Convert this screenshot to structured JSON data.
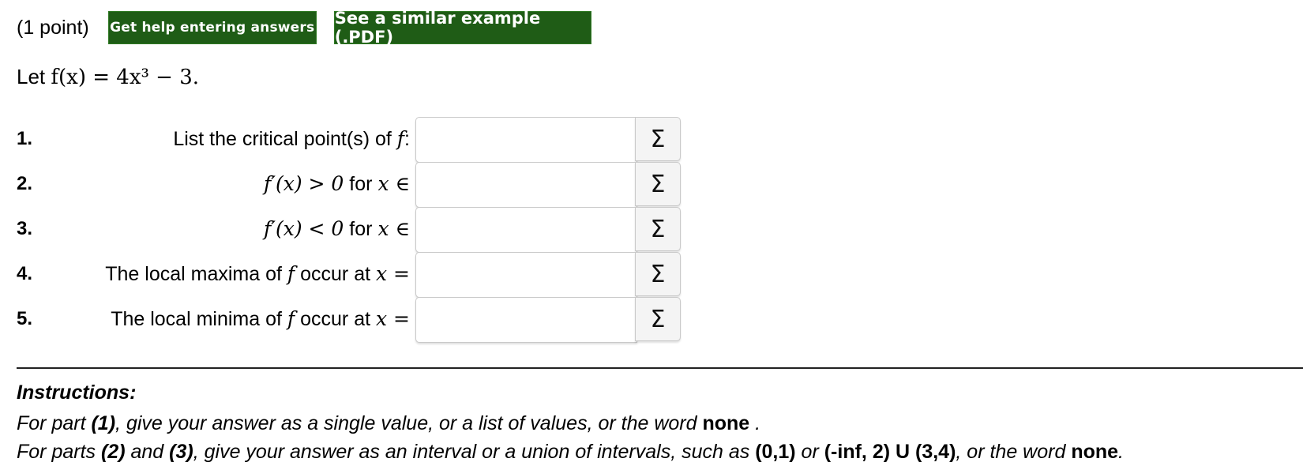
{
  "header": {
    "points": "(1 point)",
    "help_button": "Get help entering answers",
    "example_button": "See a similar example (.PDF)"
  },
  "problem": {
    "let_text": "Let",
    "function": "f(x) = 4x³ − 3."
  },
  "questions": [
    {
      "number": "1.",
      "label": "List the critical point(s) of",
      "math": "f",
      "suffix": ":",
      "answer": ""
    },
    {
      "number": "2.",
      "label_math": "f′(x) > 0",
      "label": "for",
      "math": "x ∈",
      "answer": ""
    },
    {
      "number": "3.",
      "label_math": "f′(x) < 0",
      "label": "for",
      "math": "x ∈",
      "answer": ""
    },
    {
      "number": "4.",
      "label": "The local maxima of",
      "math": "f",
      "suffix": "occur at",
      "math2": "x =",
      "answer": ""
    },
    {
      "number": "5.",
      "label": "The local minima of",
      "math": "f",
      "suffix": "occur at",
      "math2": "x =",
      "answer": ""
    }
  ],
  "sigma_icon": "Σ",
  "instructions": {
    "title": "Instructions:",
    "line1": {
      "a": "For part ",
      "b": "(1)",
      "c": ", give your answer as a single value, or a list of values, or the word ",
      "d": "none",
      "e": " ."
    },
    "line2": {
      "a": "For parts ",
      "b": "(2)",
      "c": " and ",
      "d": "(3)",
      "e": ", give your answer as an interval or a union of intervals, such as ",
      "f": "(0,1)",
      "g": " or ",
      "h": "(-inf, 2) U (3,4)",
      "i": ", or the word ",
      "j": "none",
      "k": "."
    }
  },
  "colors": {
    "button_green": "#1f5c16"
  }
}
